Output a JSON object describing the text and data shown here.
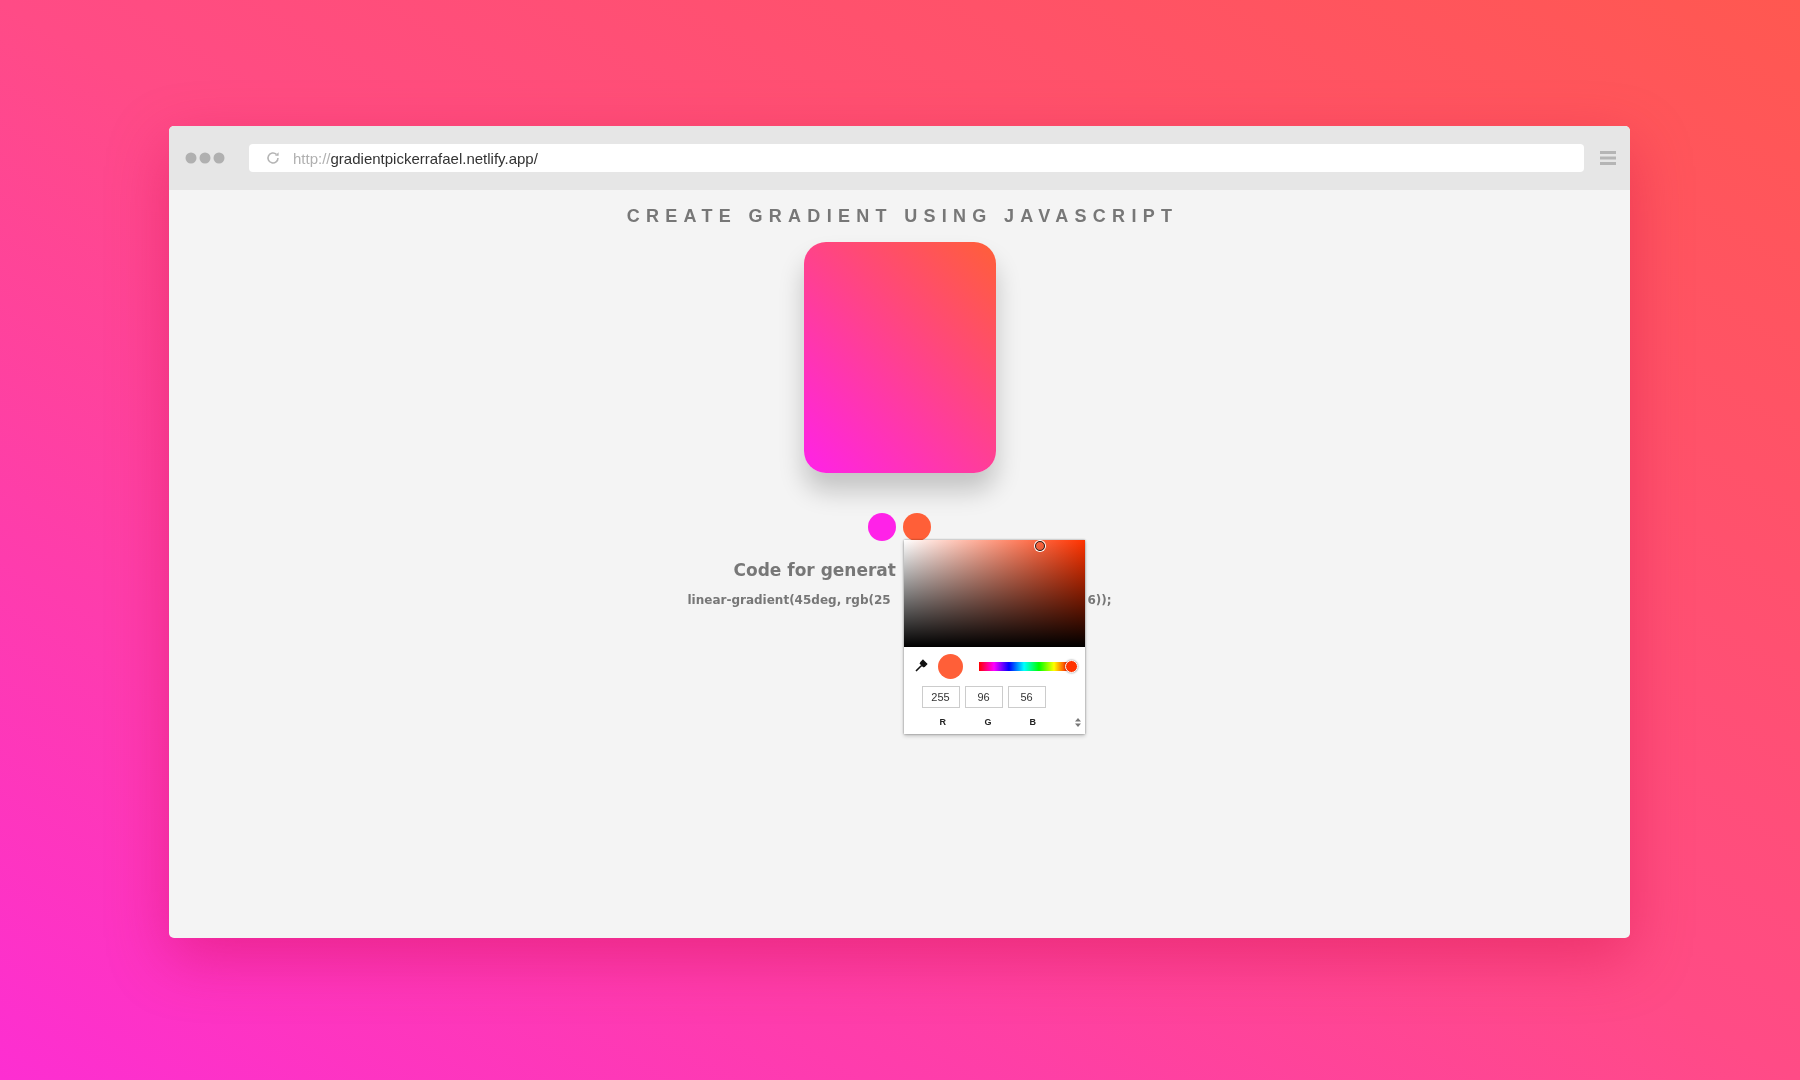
{
  "browser": {
    "url_scheme": "http://",
    "url_host": "gradientpickerrafael.netlify.app/"
  },
  "page": {
    "title": "CREATE GRADIENT USING JAVASCRIPT",
    "swatches": [
      {
        "color": "#ff22e8"
      },
      {
        "color": "#ff5f38"
      }
    ],
    "code_heading": "Code for generat",
    "code_line_start": "linear-gradient(45deg, rgb(25",
    "code_line_end": "6));"
  },
  "color_picker": {
    "hue": {
      "level": 0.97
    },
    "channels": [
      {
        "value": "255",
        "label": "R"
      },
      {
        "value": "96",
        "label": "G"
      },
      {
        "value": "56",
        "label": "B"
      }
    ]
  }
}
